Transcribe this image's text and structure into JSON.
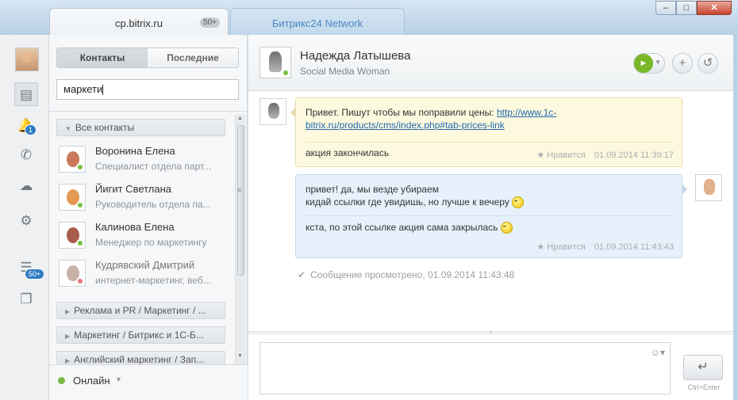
{
  "window": {
    "tabs": [
      {
        "label": "cp.bitrix.ru",
        "badge": "50+"
      },
      {
        "label": "Битрикс24 Network"
      }
    ],
    "buttons": {
      "minimize": "–",
      "maximize": "□",
      "close": "✕"
    }
  },
  "sidebar": {
    "notifications_count": "1",
    "lists_count": "50+"
  },
  "contacts": {
    "tabs": {
      "contacts": "Контакты",
      "recent": "Последние"
    },
    "search_value": "маркети",
    "all_contacts_group": "Все контакты",
    "items": [
      {
        "name": "Воронина Елена",
        "position": "Специалист отдела парт..."
      },
      {
        "name": "Йигит Светлана",
        "position": "Руководитель отдела па..."
      },
      {
        "name": "Калинова Елена",
        "position": "Менеджер по маркетингу"
      },
      {
        "name": "Кудрявский Дмитрий",
        "position": "интернет-маркетинг, веб..."
      }
    ],
    "groups": [
      "Реклама и PR / Маркетинг / ...",
      "Маркетинг / Битрикс и 1С-Б...",
      "Английский маркетинг / Зап..."
    ],
    "status": {
      "label": "Онлайн",
      "color": "#7ab946"
    }
  },
  "chat": {
    "header": {
      "name": "Надежда Латышева",
      "role": "Social Media Woman"
    },
    "messages": [
      {
        "direction": "in",
        "text_before_link": "Привет. Пишут чтобы мы поправили цены: ",
        "link_line1": "http://www.1c-",
        "link_line2": "bitrix.ru/products/cms/index.php#tab-prices-link",
        "text2": "акция закончилась",
        "like": "Нравится",
        "time": "01.09.2014 11:39:17"
      },
      {
        "direction": "out",
        "line1": "привет! да, мы везде убираем",
        "line2": "кидай ссылки где увидишь, но лучше к вечеру",
        "line3": "кста, по этой ссылке акция сама закрылась",
        "like": "Нравится",
        "time": "01.09.2014 11:43:43"
      }
    ],
    "seen": "Сообщение просмотрено, 01.09.2014 11:43:48",
    "send_hint": "Ctrl+Enter"
  },
  "colors": {
    "accent": "#2f7bc0",
    "online": "#77be40",
    "offline": "#e8737a",
    "link": "#2067b0"
  }
}
